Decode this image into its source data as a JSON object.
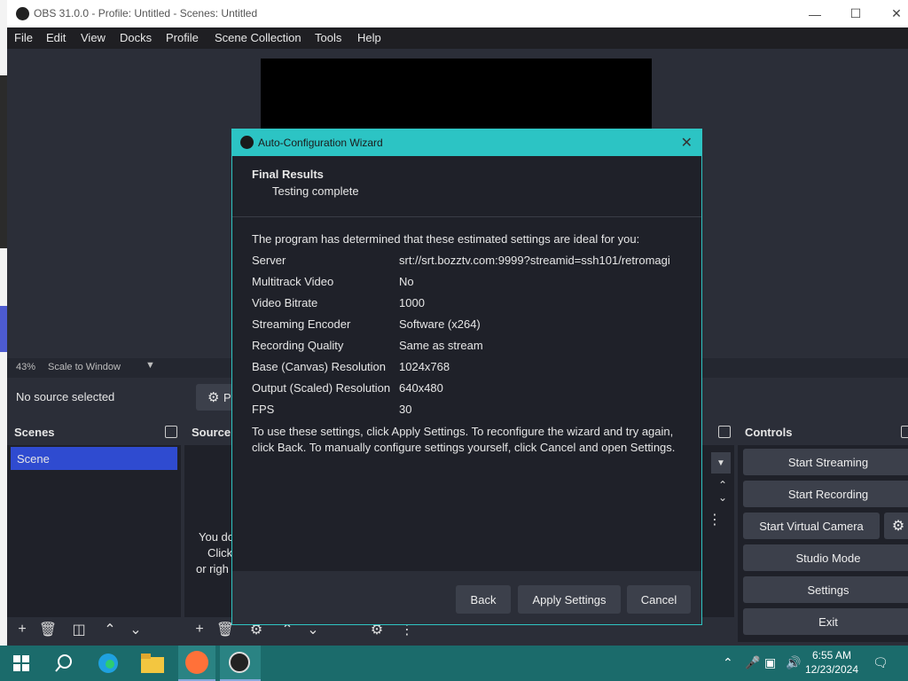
{
  "window": {
    "title": "OBS 31.0.0 - Profile: Untitled - Scenes: Untitled"
  },
  "menu": [
    "File",
    "Edit",
    "View",
    "Docks",
    "Profile",
    "Scene Collection",
    "Tools",
    "Help"
  ],
  "preview": {
    "zoom": "43%",
    "scale_mode": "Scale to Window"
  },
  "source_bar": {
    "status": "No source selected",
    "properties_partial": "P"
  },
  "scenes": {
    "title": "Scenes",
    "items": [
      "Scene"
    ]
  },
  "sources": {
    "title": "Source",
    "empty_text_1": "You do",
    "empty_text_2": "Click",
    "empty_text_3": "or righ"
  },
  "controls": {
    "title": "Controls",
    "buttons": [
      "Start Streaming",
      "Start Recording",
      "Start Virtual Camera",
      "Studio Mode",
      "Settings",
      "Exit"
    ]
  },
  "dialog": {
    "title": "Auto-Configuration Wizard",
    "heading": "Final Results",
    "subheading": "Testing complete",
    "intro": "The program has determined that these estimated settings are ideal for you:",
    "rows": [
      {
        "label": "Server",
        "value": "srt://srt.bozztv.com:9999?streamid=ssh101/retromagi"
      },
      {
        "label": "Multitrack Video",
        "value": "No"
      },
      {
        "label": "Video Bitrate",
        "value": "1000"
      },
      {
        "label": "Streaming Encoder",
        "value": "Software (x264)"
      },
      {
        "label": "Recording Quality",
        "value": "Same as stream"
      },
      {
        "label": "Base (Canvas) Resolution",
        "value": "1024x768"
      },
      {
        "label": "Output (Scaled) Resolution",
        "value": "640x480"
      },
      {
        "label": "FPS",
        "value": "30"
      }
    ],
    "outro": "To use these settings, click Apply Settings. To reconfigure the wizard and try again, click Back. To manually configure settings yourself, click Cancel and open Settings.",
    "buttons": {
      "back": "Back",
      "apply": "Apply Settings",
      "cancel": "Cancel"
    }
  },
  "taskbar": {
    "time": "6:55 AM",
    "date": "12/23/2024"
  }
}
